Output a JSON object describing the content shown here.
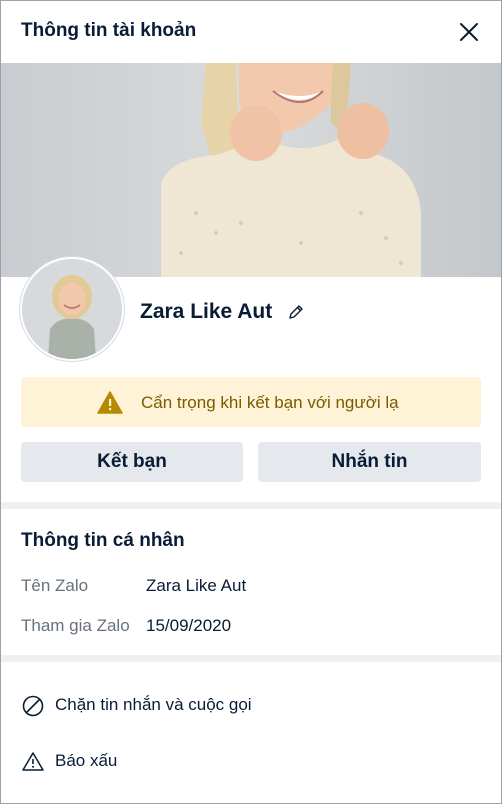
{
  "dialog": {
    "title": "Thông tin tài khoản",
    "close_icon": "close-icon"
  },
  "profile": {
    "name": "Zara Like Aut",
    "edit_icon": "pencil-icon"
  },
  "warning": {
    "icon": "warning-icon",
    "text": "Cẩn trọng khi kết bạn với người lạ",
    "color": "#b58900",
    "background": "#fef3d6"
  },
  "actions": {
    "add_friend": "Kết bạn",
    "message": "Nhắn tin"
  },
  "personal_info": {
    "title": "Thông tin cá nhân",
    "rows": [
      {
        "label": "Tên Zalo",
        "value": "Zara Like Aut"
      },
      {
        "label": "Tham gia Zalo",
        "value": "15/09/2020"
      }
    ]
  },
  "menu": {
    "block": {
      "icon": "block-icon",
      "label": "Chặn tin nhắn và cuộc gọi"
    },
    "report": {
      "icon": "warning-outline-icon",
      "label": "Báo xấu"
    }
  }
}
